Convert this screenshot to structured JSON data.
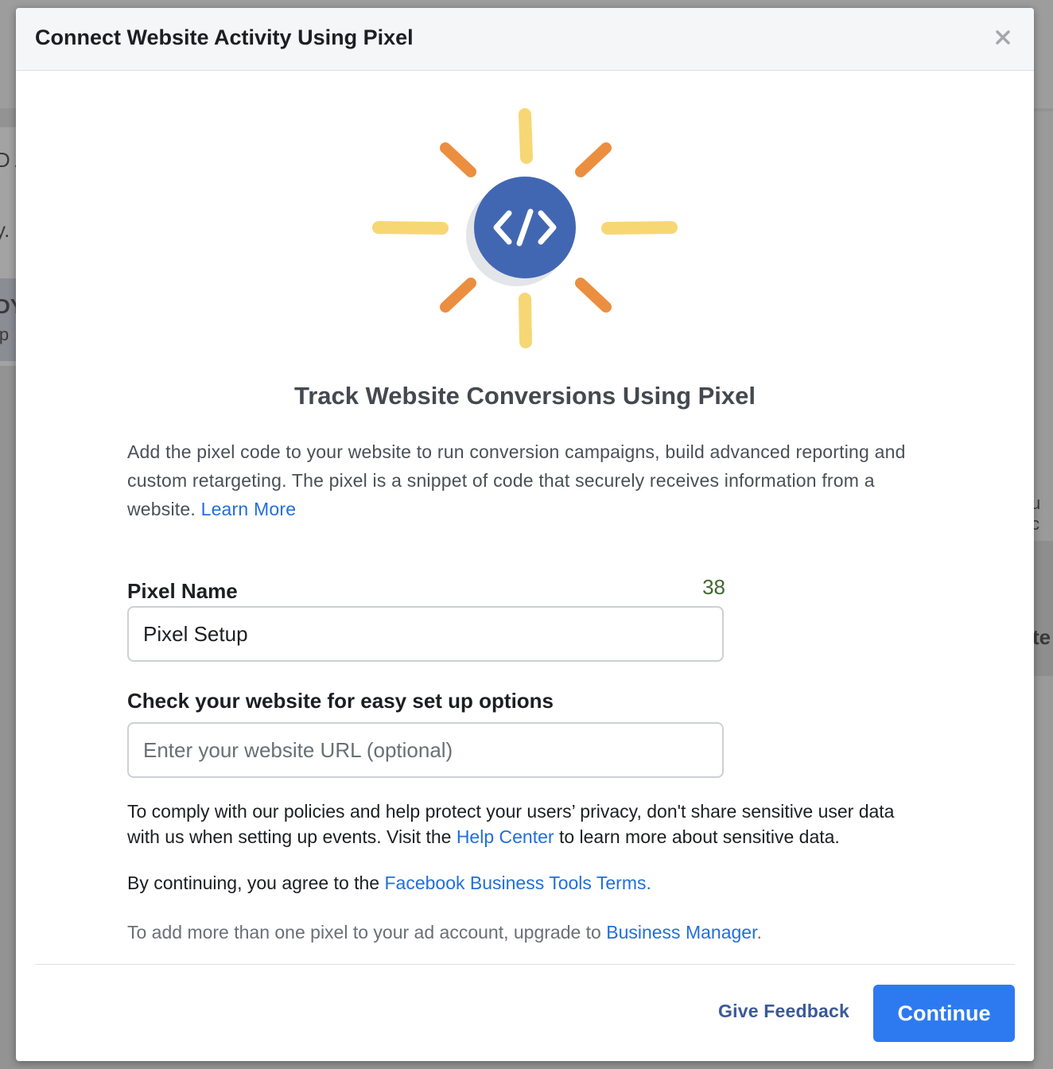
{
  "modal": {
    "title": "Connect Website Activity Using Pixel",
    "close_label": "×"
  },
  "hero": {
    "icon": "code-brackets-icon",
    "circle_color": "#4267b2",
    "ray_colors": [
      "#f7d774",
      "#ec8e3f"
    ]
  },
  "content": {
    "headline": "Track Website Conversions Using Pixel",
    "description": "Add the pixel code to your website to run conversion campaigns, build advanced reporting and custom retargeting. The pixel is a snippet of code that securely receives information from a website.",
    "learn_more": "Learn More"
  },
  "pixel_name": {
    "label": "Pixel Name",
    "counter": "38",
    "value": "Pixel Setup"
  },
  "website": {
    "label": "Check your website for easy set up options",
    "placeholder": "Enter your website URL (optional)"
  },
  "policy": {
    "text_before": "To comply with our policies and help protect your users’ privacy, don't share sensitive user data with us when setting up events. Visit the",
    "link": "Help Center",
    "text_after": "to learn more about sensitive data."
  },
  "terms": {
    "text_before": "By continuing, you agree to the",
    "link": "Facebook Business Tools Terms."
  },
  "upgrade": {
    "text_before": "To add more than one pixel to your ad account, upgrade to",
    "link": "Business Manager",
    "text_after": "."
  },
  "footer": {
    "feedback_label": "Give Feedback",
    "continue_label": "Continue"
  },
  "background": {
    "fragments": [
      "D A",
      "y.",
      "DY",
      "ip",
      "u c",
      "te"
    ]
  },
  "colors": {
    "accent": "#2d7af0",
    "link": "#216fdb",
    "counter": "#42672e"
  }
}
